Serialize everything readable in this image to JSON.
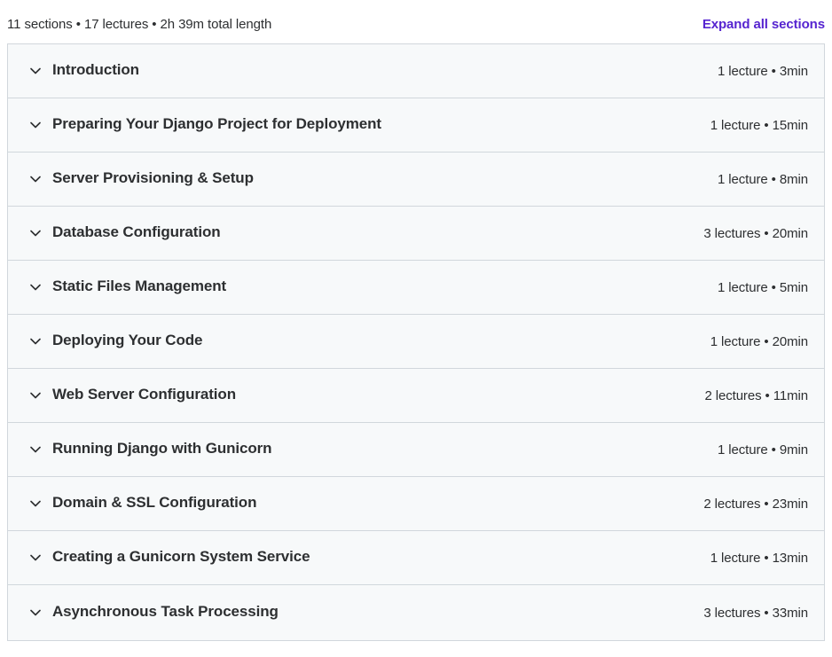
{
  "summary": {
    "text": "11 sections • 17 lectures • 2h 39m total length",
    "expand_all_label": "Expand all sections"
  },
  "colors": {
    "accent": "#5624d0",
    "row_background": "#f7f9fa",
    "border": "#d1d7dc",
    "text": "#2d2f31"
  },
  "sections": [
    {
      "title": "Introduction",
      "meta": "1 lecture • 3min",
      "icon": "chevron-down-icon"
    },
    {
      "title": "Preparing Your Django Project for Deployment",
      "meta": "1 lecture • 15min",
      "icon": "chevron-down-icon"
    },
    {
      "title": "Server Provisioning & Setup",
      "meta": "1 lecture • 8min",
      "icon": "chevron-down-icon"
    },
    {
      "title": "Database Configuration",
      "meta": "3 lectures • 20min",
      "icon": "chevron-down-icon"
    },
    {
      "title": "Static Files Management",
      "meta": "1 lecture • 5min",
      "icon": "chevron-down-icon"
    },
    {
      "title": "Deploying Your Code",
      "meta": "1 lecture • 20min",
      "icon": "chevron-down-icon"
    },
    {
      "title": "Web Server Configuration",
      "meta": "2 lectures • 11min",
      "icon": "chevron-down-icon"
    },
    {
      "title": "Running Django with Gunicorn",
      "meta": "1 lecture • 9min",
      "icon": "chevron-down-icon"
    },
    {
      "title": "Domain & SSL Configuration",
      "meta": "2 lectures • 23min",
      "icon": "chevron-down-icon"
    },
    {
      "title": "Creating a Gunicorn System Service",
      "meta": "1 lecture • 13min",
      "icon": "chevron-down-icon"
    },
    {
      "title": "Asynchronous Task Processing",
      "meta": "3 lectures • 33min",
      "icon": "chevron-down-icon"
    }
  ]
}
